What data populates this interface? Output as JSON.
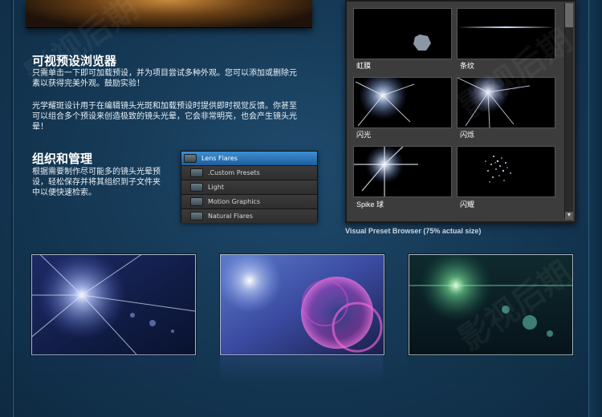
{
  "sections": {
    "preset_browser": {
      "title": "可视预设浏览器",
      "para1_lines": [
        "只需单击一下即可加载预设，并为项目尝试多种外观。您可以添加或删除元",
        "素以获得完美外观。鼓励实验！"
      ],
      "para2_lines": [
        "光学耀斑设计用于在编辑镜头光斑和加载预设时提供即时视觉反馈。你甚至",
        "可以组合多个预设来创造极致的镜头光晕，它会非常明亮，也会产生镜头光",
        "晕！"
      ]
    },
    "organize": {
      "title": "组织和管理",
      "para_lines": [
        "根据需要制作尽可能多的镜头光晕预",
        "设，轻松保存并将其组织到子文件夹",
        "中以便快速检索。"
      ]
    }
  },
  "layers": {
    "items": [
      {
        "label": "Lens Flares",
        "selected": true
      },
      {
        "label": ".Custom Presets"
      },
      {
        "label": "Light"
      },
      {
        "label": "Motion Graphics"
      },
      {
        "label": "Natural Flares"
      }
    ]
  },
  "browser": {
    "thumbnails": [
      {
        "label": "虹膜"
      },
      {
        "label": "条纹"
      },
      {
        "label": "闪光"
      },
      {
        "label": "闪烁"
      },
      {
        "label": "Spike 球"
      },
      {
        "label": "闪耀"
      }
    ],
    "scroll_arrow": "▼",
    "caption": "Visual Preset Browser (75% actual size)"
  },
  "watermark_text": "影视后期"
}
